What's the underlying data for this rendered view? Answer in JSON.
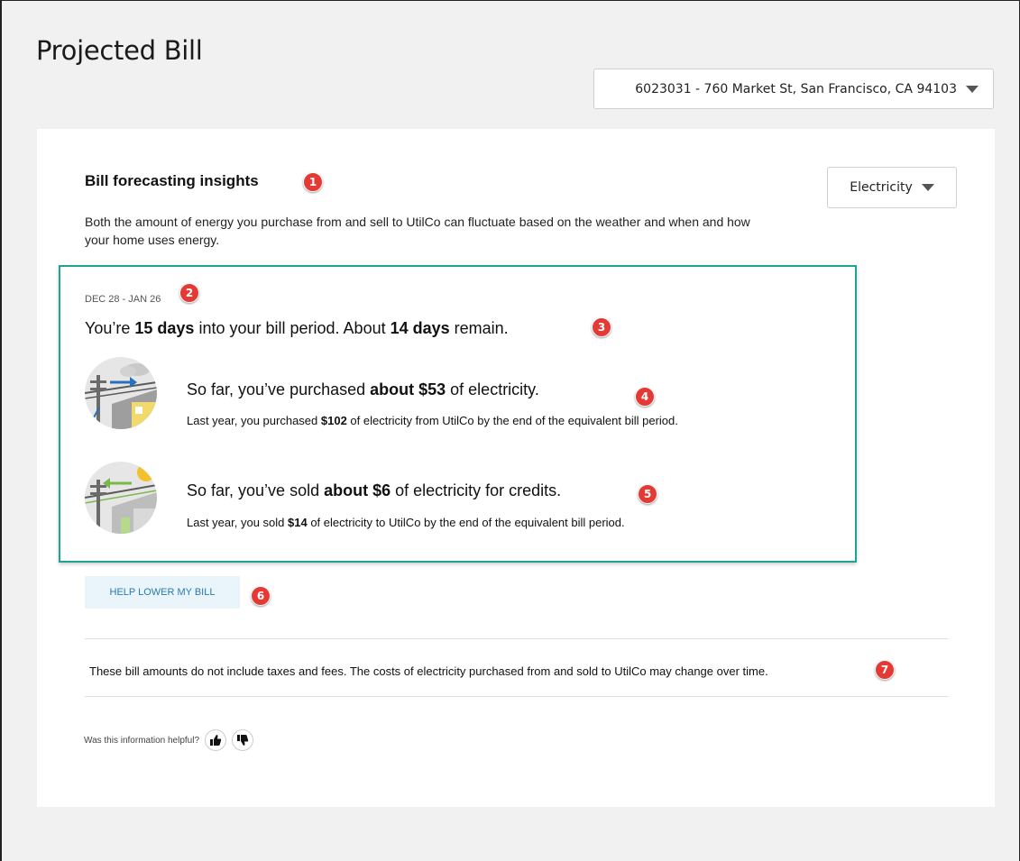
{
  "page": {
    "title": "Projected Bill"
  },
  "account_select": {
    "value": "6023031 - 760 Market St, San Francisco, CA 94103"
  },
  "insights": {
    "title": "Bill forecasting insights",
    "energy_select": "Electricity",
    "intro": "Both the amount of energy you purchase from and sell to UtilCo can fluctuate based on the weather and when and how your home uses energy."
  },
  "forecast": {
    "period": "DEC 28 - JAN 26",
    "summary": {
      "prefix": "You’re ",
      "days_in": "15 days",
      "middle": " into your bill period. About ",
      "days_left": "14 days",
      "suffix": " remain."
    },
    "purchased": {
      "prefix": "So far, you’ve purchased ",
      "amount": "about $53",
      "suffix": " of electricity.",
      "sub_prefix": "Last year, you purchased ",
      "sub_amount": "$102",
      "sub_suffix": " of electricity from UtilCo by the end of the equivalent bill period.",
      "icon": "purchase-power-lines-icon"
    },
    "sold": {
      "prefix": "So far, you’ve sold ",
      "amount": "about $6",
      "suffix": " of electricity for credits.",
      "sub_prefix": "Last year, you sold ",
      "sub_amount": "$14",
      "sub_suffix": " of electricity to UtilCo by the end of the equivalent bill period.",
      "icon": "sell-solar-power-icon"
    }
  },
  "help_button": {
    "label": "HELP LOWER MY BILL"
  },
  "disclaimer": "These bill amounts do not include taxes and fees. The costs of electricity purchased from and sold to UtilCo may change over time.",
  "feedback": {
    "question": "Was this information helpful?",
    "up_icon": "thumbs-up-icon",
    "down_icon": "thumbs-down-icon"
  },
  "badges": [
    "1",
    "2",
    "3",
    "4",
    "5",
    "6",
    "7"
  ],
  "colors": {
    "accent_border": "#1fa393",
    "badge": "#e53935",
    "help_button_bg": "#e9f4fb",
    "help_button_text": "#2a7ab0"
  }
}
